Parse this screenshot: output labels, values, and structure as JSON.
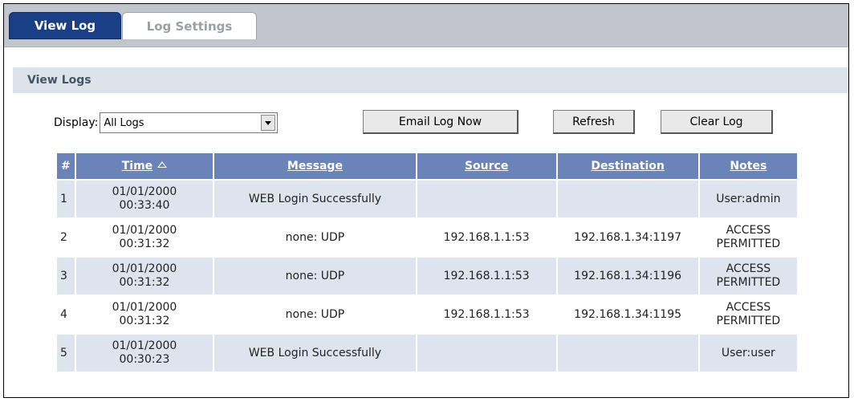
{
  "tabs": [
    {
      "label": "View Log",
      "active": true
    },
    {
      "label": "Log Settings",
      "active": false
    }
  ],
  "section": {
    "title": "View Logs"
  },
  "controls": {
    "display_label": "Display:",
    "display_value": "All Logs",
    "email_label": "Email Log Now",
    "refresh_label": "Refresh",
    "clear_label": "Clear Log"
  },
  "table": {
    "headers": {
      "num": "#",
      "time": "Time",
      "message": "Message",
      "source": "Source",
      "destination": "Destination",
      "notes": "Notes"
    },
    "rows": [
      {
        "num": "1",
        "date": "01/01/2000",
        "time": "00:33:40",
        "message": "WEB Login Successfully",
        "source": "",
        "destination": "",
        "notes1": "User:admin",
        "notes2": ""
      },
      {
        "num": "2",
        "date": "01/01/2000",
        "time": "00:31:32",
        "message": "none: UDP",
        "source": "192.168.1.1:53",
        "destination": "192.168.1.34:1197",
        "notes1": "ACCESS",
        "notes2": "PERMITTED"
      },
      {
        "num": "3",
        "date": "01/01/2000",
        "time": "00:31:32",
        "message": "none: UDP",
        "source": "192.168.1.1:53",
        "destination": "192.168.1.34:1196",
        "notes1": "ACCESS",
        "notes2": "PERMITTED"
      },
      {
        "num": "4",
        "date": "01/01/2000",
        "time": "00:31:32",
        "message": "none: UDP",
        "source": "192.168.1.1:53",
        "destination": "192.168.1.34:1195",
        "notes1": "ACCESS",
        "notes2": "PERMITTED"
      },
      {
        "num": "5",
        "date": "01/01/2000",
        "time": "00:30:23",
        "message": "WEB Login Successfully",
        "source": "",
        "destination": "",
        "notes1": "User:user",
        "notes2": ""
      }
    ]
  },
  "colors": {
    "active_tab": "#1a3f86",
    "header_bg": "#6a83b8",
    "row_alt": "#dee4ee",
    "section_bg": "#dde3ea"
  }
}
